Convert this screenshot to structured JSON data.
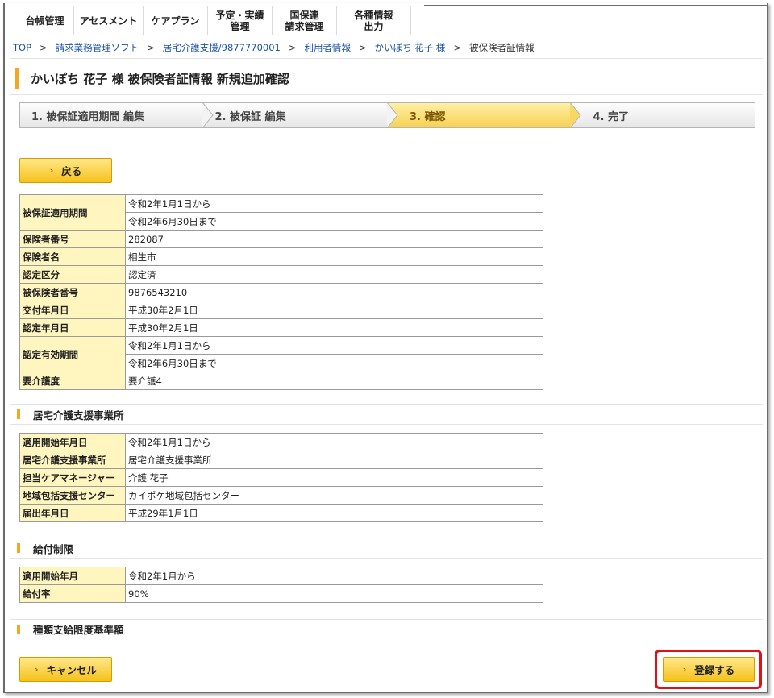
{
  "nav": {
    "items": [
      {
        "label": "台帳管理"
      },
      {
        "label": "アセスメント"
      },
      {
        "label": "ケアプラン"
      },
      {
        "label": "予定・実績\n管理"
      },
      {
        "label": "国保連\n請求管理"
      },
      {
        "label": "各種情報\n出力"
      }
    ]
  },
  "breadcrumb": {
    "items": [
      "TOP",
      "請求業務管理ソフト",
      "居宅介護支援/9877770001",
      "利用者情報",
      "かいぽち 花子 様"
    ],
    "current": "被保険者証情報",
    "separator": ">"
  },
  "page": {
    "title": "かいぽち 花子 様 被保険者証情報  新規追加確認"
  },
  "steps": [
    {
      "label": "1. 被保証適用期間 編集",
      "active": false
    },
    {
      "label": "2. 被保証 編集",
      "active": false
    },
    {
      "label": "3. 確認",
      "active": true
    },
    {
      "label": "4. 完了",
      "active": false
    }
  ],
  "buttons": {
    "back": "戻る",
    "cancel": "キャンセル",
    "register": "登録する"
  },
  "insurance": {
    "period_label": "被保証適用期間",
    "period_from": "令和2年1月1日から",
    "period_to": "令和2年6月30日まで",
    "insurer_no_label": "保険者番号",
    "insurer_no": "282087",
    "insurer_name_label": "保険者名",
    "insurer_name": "相生市",
    "cert_class_label": "認定区分",
    "cert_class": "認定済",
    "insured_no_label": "被保険者番号",
    "insured_no": "9876543210",
    "issue_date_label": "交付年月日",
    "issue_date": "平成30年2月1日",
    "cert_date_label": "認定年月日",
    "cert_date": "平成30年2月1日",
    "valid_label": "認定有効期間",
    "valid_from": "令和2年1月1日から",
    "valid_to": "令和2年6月30日まで",
    "care_level_label": "要介護度",
    "care_level": "要介護4"
  },
  "office": {
    "heading": "居宅介護支援事業所",
    "start_label": "適用開始年月日",
    "start": "令和2年1月1日から",
    "office_label": "居宅介護支援事業所",
    "office": "居宅介護支援事業所",
    "manager_label": "担当ケアマネージャー",
    "manager": "介護 花子",
    "center_label": "地域包括支援センター",
    "center": "カイポケ地域包括センター",
    "notified_label": "届出年月日",
    "notified": "平成29年1月1日"
  },
  "benefit": {
    "heading": "給付制限",
    "start_label": "適用開始年月",
    "start": "令和2年1月から",
    "rate_label": "給付率",
    "rate": "90%"
  },
  "limit": {
    "heading": "種類支給限度基準額"
  },
  "colors": {
    "accent": "#f5a623",
    "button": "#f5c21b",
    "label_bg": "#fff5bf",
    "link": "#1a53a8",
    "highlight": "#e0101b"
  }
}
